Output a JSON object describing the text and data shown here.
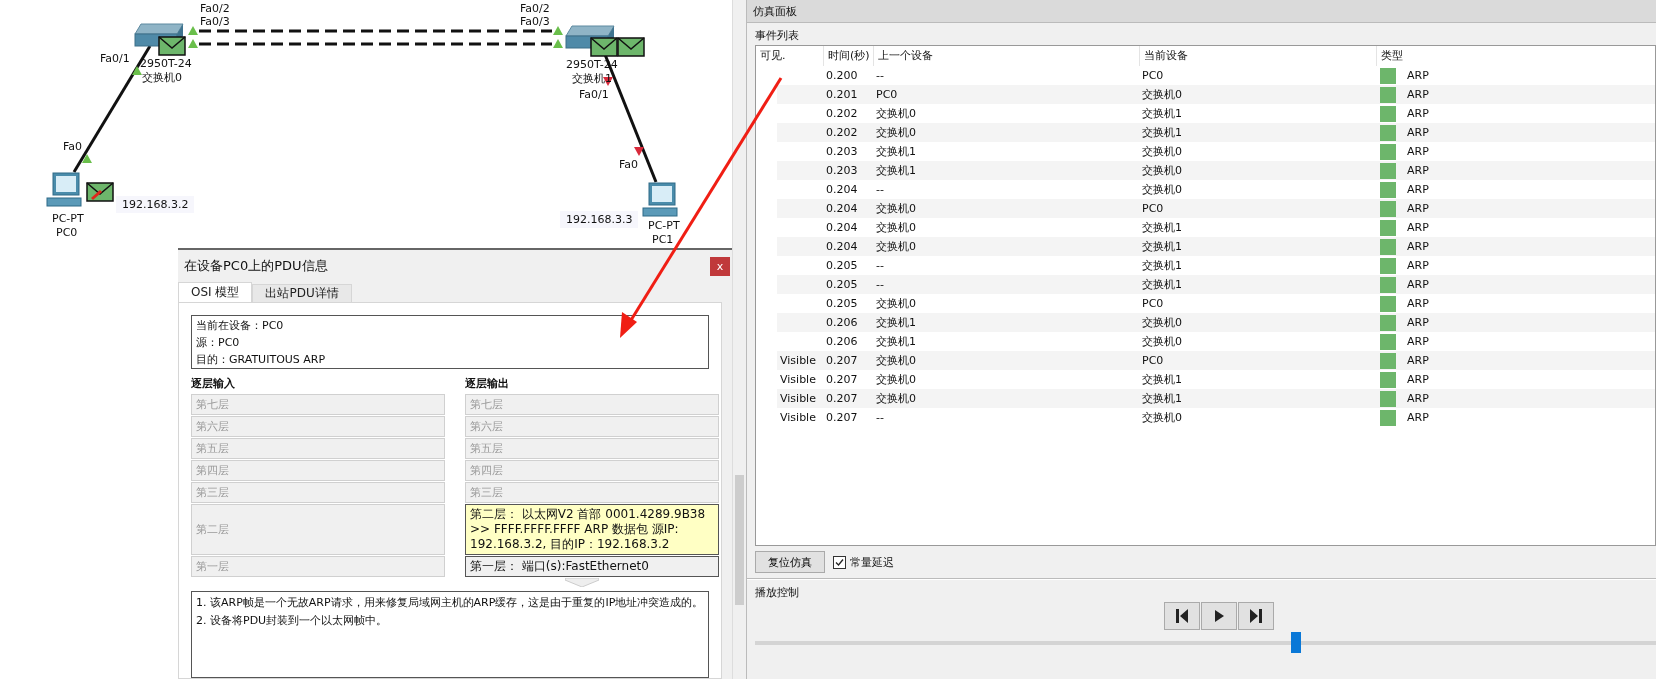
{
  "topology": {
    "devices": [
      {
        "kind": "switch",
        "model": "2950T-24",
        "name": "交换机0",
        "pdus": [
          {
            "kind": "plain"
          }
        ],
        "ports": [
          {
            "label": "Fa0/2",
            "link_up": true
          },
          {
            "label": "Fa0/3",
            "link_up": true
          },
          {
            "label": "Fa0/1",
            "link_up": true
          }
        ]
      },
      {
        "kind": "switch",
        "model": "2950T-24",
        "name": "交换机1",
        "pdus": [
          {
            "kind": "plain"
          },
          {
            "kind": "plain"
          }
        ],
        "ports": [
          {
            "label": "Fa0/2",
            "link_up": true
          },
          {
            "label": "Fa0/3",
            "link_up": true
          },
          {
            "label": "Fa0/1",
            "link_up": false
          }
        ]
      },
      {
        "kind": "pc",
        "model": "PC-PT",
        "name": "PC0",
        "ip": "192.168.3.2",
        "pdus": [
          {
            "kind": "marked"
          }
        ],
        "ports": [
          {
            "label": "Fa0",
            "link_up": true
          }
        ]
      },
      {
        "kind": "pc",
        "model": "PC-PT",
        "name": "PC1",
        "ip": "192.168.3.3",
        "ports": [
          {
            "label": "Fa0",
            "link_up": false
          }
        ]
      }
    ],
    "links": [
      {
        "kind": "dashed"
      },
      {
        "kind": "dashed"
      },
      {
        "kind": "solid"
      },
      {
        "kind": "solid"
      }
    ]
  },
  "pdu_dialog": {
    "title": "在设备PC0上的PDU信息",
    "close": "x",
    "tabs": [
      {
        "label": "OSI 模型",
        "selected": true
      },
      {
        "label": "出站PDU详情",
        "selected": false
      }
    ],
    "info": [
      "当前在设备：PC0",
      "源：PC0",
      "目的：GRATUITOUS ARP"
    ],
    "in_heading": "逐层输入",
    "out_heading": "逐层输出",
    "in_layers": [
      {
        "label": "第七层",
        "active": false
      },
      {
        "label": "第六层",
        "active": false
      },
      {
        "label": "第五层",
        "active": false
      },
      {
        "label": "第四层",
        "active": false
      },
      {
        "label": "第三层",
        "active": false
      },
      {
        "label": "第二层",
        "active": false
      },
      {
        "label": "第一层",
        "active": false
      }
    ],
    "out_layers": [
      {
        "label": "第七层",
        "active": false,
        "highlighted": false
      },
      {
        "label": "第六层",
        "active": false,
        "highlighted": false
      },
      {
        "label": "第五层",
        "active": false,
        "highlighted": false
      },
      {
        "label": "第四层",
        "active": false,
        "highlighted": false
      },
      {
        "label": "第三层",
        "active": false,
        "highlighted": false
      },
      {
        "label": "第二层：  以太网V2 首部 0001.4289.9B38 >> FFFF.FFFF.FFFF ARP 数据包 源IP: 192.168.3.2, 目的IP：192.168.3.2",
        "active": true,
        "highlighted": true
      },
      {
        "label": "第一层：  端口(s):FastEthernet0",
        "active": true,
        "highlighted": false
      }
    ],
    "notes": [
      "1. 该ARP帧是一个无故ARP请求，用来修复局域网主机的ARP缓存，这是由于重复的IP地址冲突造成的。",
      "2. 设备将PDU封装到一个以太网帧中。"
    ]
  },
  "sim_panel": {
    "title": "仿真面板",
    "event_list_label": "事件列表",
    "columns": [
      "可见.",
      "时间(秒)",
      "上一个设备",
      "当前设备",
      "类型"
    ],
    "rows": [
      {
        "time": "0.200",
        "last": "--",
        "current": "PC0",
        "type": "ARP",
        "color": "#6db66b"
      },
      {
        "time": "0.201",
        "last": "PC0",
        "current": "交换机0",
        "type": "ARP",
        "color": "#6db66b"
      },
      {
        "time": "0.202",
        "last": "交换机0",
        "current": "交换机1",
        "type": "ARP",
        "color": "#6db66b"
      },
      {
        "time": "0.202",
        "last": "交换机0",
        "current": "交换机1",
        "type": "ARP",
        "color": "#6db66b"
      },
      {
        "time": "0.203",
        "last": "交换机1",
        "current": "交换机0",
        "type": "ARP",
        "color": "#6db66b"
      },
      {
        "time": "0.203",
        "last": "交换机1",
        "current": "交换机0",
        "type": "ARP",
        "color": "#6db66b"
      },
      {
        "time": "0.204",
        "last": "--",
        "current": "交换机0",
        "type": "ARP",
        "color": "#6db66b"
      },
      {
        "time": "0.204",
        "last": "交换机0",
        "current": "PC0",
        "type": "ARP",
        "color": "#6db66b"
      },
      {
        "time": "0.204",
        "last": "交换机0",
        "current": "交换机1",
        "type": "ARP",
        "color": "#6db66b"
      },
      {
        "time": "0.204",
        "last": "交换机0",
        "current": "交换机1",
        "type": "ARP",
        "color": "#6db66b"
      },
      {
        "time": "0.205",
        "last": "--",
        "current": "交换机1",
        "type": "ARP",
        "color": "#6db66b"
      },
      {
        "time": "0.205",
        "last": "--",
        "current": "交换机1",
        "type": "ARP",
        "color": "#6db66b"
      },
      {
        "time": "0.205",
        "last": "交换机0",
        "current": "PC0",
        "type": "ARP",
        "color": "#6db66b"
      },
      {
        "time": "0.206",
        "last": "交换机1",
        "current": "交换机0",
        "type": "ARP",
        "color": "#6db66b"
      },
      {
        "time": "0.206",
        "last": "交换机1",
        "current": "交换机0",
        "type": "ARP",
        "color": "#6db66b"
      },
      {
        "visible": "Visible",
        "time": "0.207",
        "last": "交换机0",
        "current": "PC0",
        "type": "ARP",
        "color": "#6db66b"
      },
      {
        "visible": "Visible",
        "time": "0.207",
        "last": "交换机0",
        "current": "交换机1",
        "type": "ARP",
        "color": "#6db66b"
      },
      {
        "visible": "Visible",
        "time": "0.207",
        "last": "交换机0",
        "current": "交换机1",
        "type": "ARP",
        "color": "#6db66b"
      },
      {
        "visible": "Visible",
        "time": "0.207",
        "last": "--",
        "current": "交换机0",
        "type": "ARP",
        "color": "#6db66b"
      }
    ],
    "reset_button": "复位仿真",
    "constant_delay": {
      "label": "常量延迟",
      "checked": true
    },
    "playback_label": "播放控制",
    "playback_buttons": [
      {
        "kind": "back"
      },
      {
        "kind": "play"
      },
      {
        "kind": "forward"
      }
    ],
    "speed": {
      "level": 0.6
    }
  }
}
